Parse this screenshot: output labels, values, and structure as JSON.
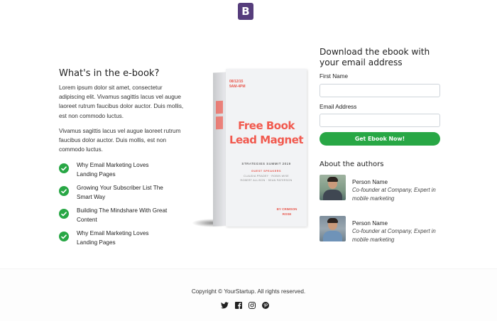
{
  "logo": {
    "letter": "B",
    "color": "#563d7c"
  },
  "features": {
    "heading": "What's in the e-book?",
    "paragraph1": "Lorem ipsum dolor sit amet, consectetur adipiscing elit. Vivamus sagittis lacus vel augue laoreet rutrum faucibus dolor auctor. Duis mollis, est non commodo luctus.",
    "paragraph2": "Vivamus sagittis lacus vel augue laoreet rutrum faucibus dolor auctor. Duis mollis, est non commodo luctus.",
    "items": [
      {
        "label": "Why Email Marketing Loves Landing Pages",
        "icon": "check-circle-icon"
      },
      {
        "label": "Growing Your Subscriber List The Smart Way",
        "icon": "check-circle-icon"
      },
      {
        "label": "Building The Mindshare With Great Content",
        "icon": "check-circle-icon"
      },
      {
        "label": "Why Email Marketing Loves Landing Pages",
        "icon": "check-circle-icon"
      }
    ],
    "check_color": "#28a745"
  },
  "book": {
    "date": "08/12/15",
    "time": "9AM-4PM",
    "title_line1": "Free Book",
    "title_line2": "Lead Magnet",
    "summit": "STRATEGIES SUMMIT 2019",
    "guest_label": "GUEST SPEAKERS",
    "speakers_line1": "CLAUDIA PRADEY · ROBIN WISE",
    "speakers_line2": "ROBERT ALLISON · SEAN PATERSON",
    "by_line1": "BY CRIMSON",
    "by_line2": "ROSE",
    "accent_color": "#f15a4f"
  },
  "signup": {
    "heading": "Download the ebook with your email address",
    "first_name_label": "First Name",
    "first_name_value": "",
    "email_label": "Email Address",
    "email_value": "",
    "submit_label": "Get Ebook Now!",
    "button_color": "#28a745"
  },
  "authors": {
    "heading": "About the authors",
    "list": [
      {
        "name": "Person Name",
        "role": "Co-founder at Company, Expert in mobile marketing"
      },
      {
        "name": "Person Name",
        "role": "Co-founder at Company, Expert in mobile marketing"
      }
    ]
  },
  "footer": {
    "copyright": "Copyright © YourStartup. All rights reserved.",
    "social": [
      "twitter-icon",
      "facebook-icon",
      "instagram-icon",
      "pinterest-icon"
    ]
  }
}
